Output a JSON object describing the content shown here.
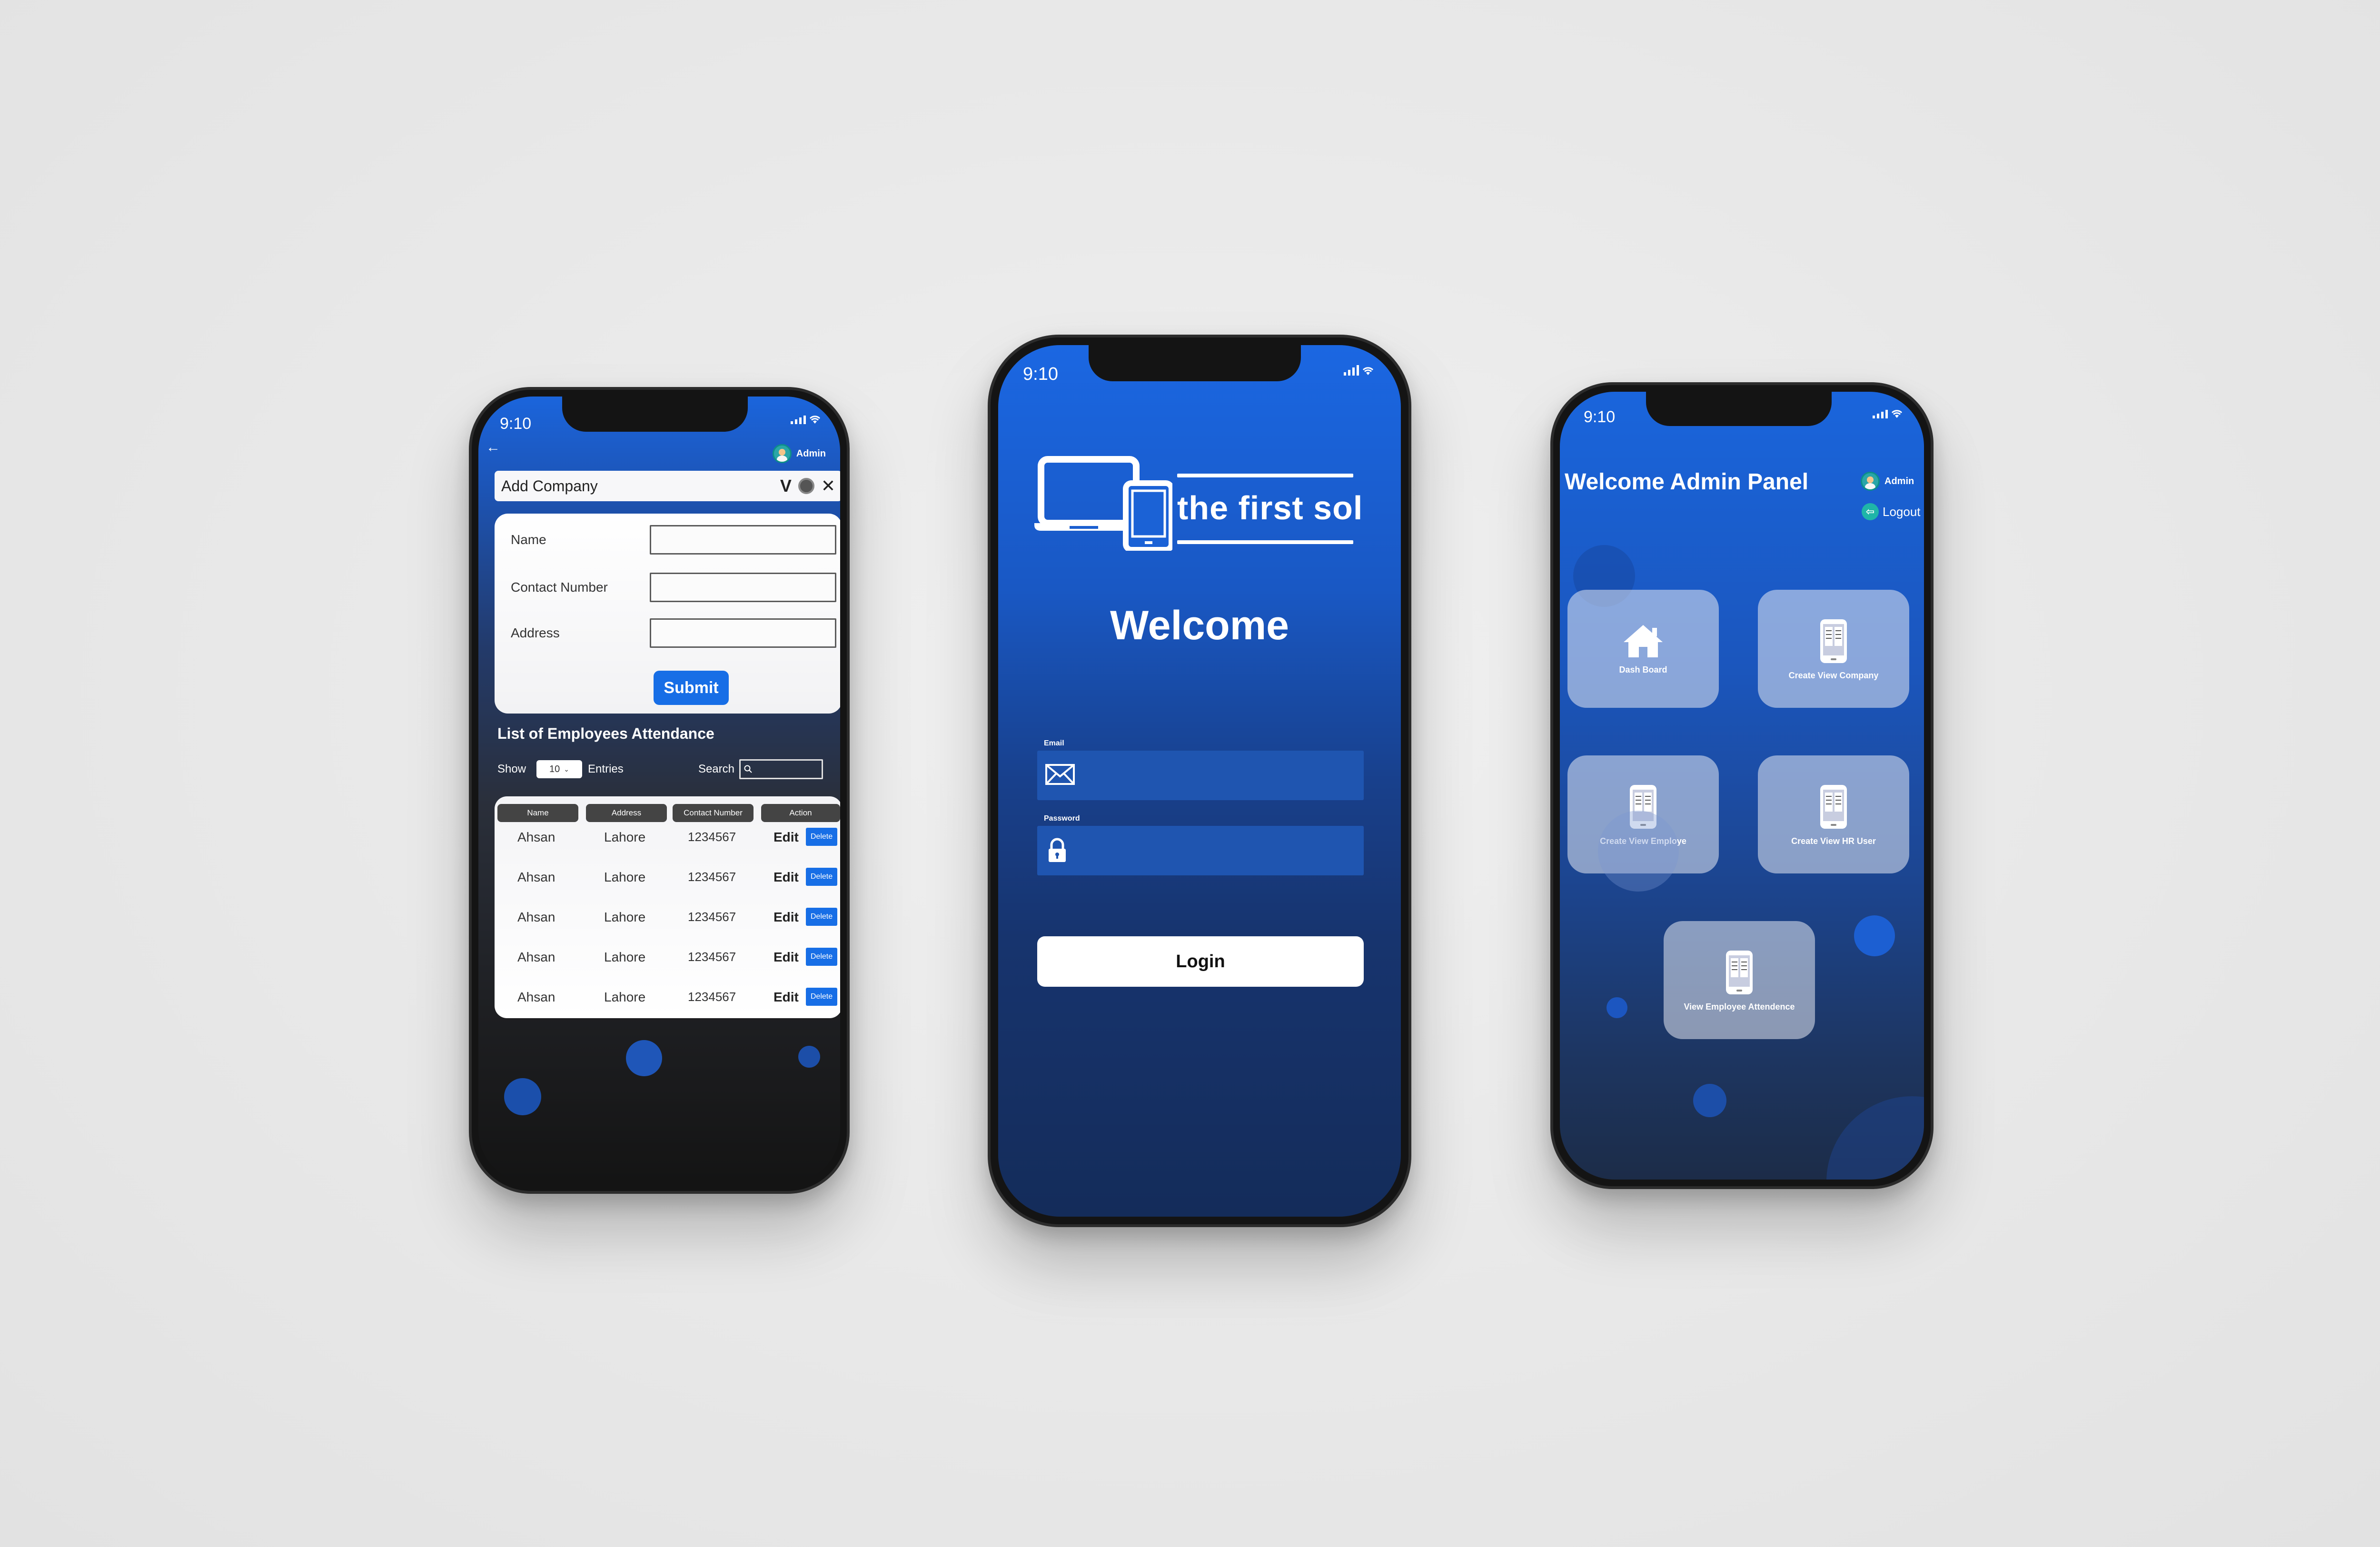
{
  "phone_left": {
    "status": {
      "time": "9:10"
    },
    "admin_label": "Admin",
    "add_company": {
      "title": "Add Company",
      "minimize_label": "V",
      "close_label": "✕"
    },
    "form": {
      "fields": [
        {
          "label": "Name"
        },
        {
          "label": "Contact Number"
        },
        {
          "label": "Address"
        }
      ],
      "submit_label": "Submit"
    },
    "list": {
      "title": "List of Employees Attendance",
      "show_label": "Show",
      "show_value": "10",
      "entries_label": "Entries",
      "search_label": "Search",
      "columns": [
        "Name",
        "Address",
        "Contact Number",
        "Action"
      ],
      "rows": [
        {
          "name": "Ahsan",
          "address": "Lahore",
          "contact": "1234567",
          "edit": "Edit",
          "delete": "Delete"
        },
        {
          "name": "Ahsan",
          "address": "Lahore",
          "contact": "1234567",
          "edit": "Edit",
          "delete": "Delete"
        },
        {
          "name": "Ahsan",
          "address": "Lahore",
          "contact": "1234567",
          "edit": "Edit",
          "delete": "Delete"
        },
        {
          "name": "Ahsan",
          "address": "Lahore",
          "contact": "1234567",
          "edit": "Edit",
          "delete": "Delete"
        },
        {
          "name": "Ahsan",
          "address": "Lahore",
          "contact": "1234567",
          "edit": "Edit",
          "delete": "Delete"
        }
      ]
    }
  },
  "phone_center": {
    "status": {
      "time": "9:10"
    },
    "logo_text": "the first sol",
    "welcome": "Welcome",
    "email_label": "Email",
    "password_label": "Password",
    "login_label": "Login"
  },
  "phone_right": {
    "status": {
      "time": "9:10"
    },
    "title": "Welcome Admin Panel",
    "admin_label": "Admin",
    "logout_label": "Logout",
    "tiles": [
      {
        "label": "Dash Board",
        "icon": "home-icon"
      },
      {
        "label": "Create View Company",
        "icon": "phone-document-icon"
      },
      {
        "label": "Create View Employe",
        "icon": "phone-document-icon"
      },
      {
        "label": "Create View HR User",
        "icon": "phone-document-icon"
      },
      {
        "label": "View Employee Attendence",
        "icon": "phone-document-icon"
      }
    ]
  },
  "colors": {
    "accent_blue": "#176ee6",
    "screen_blue": "#1b65dc",
    "dark": "#141414",
    "background": "#e8e8e8"
  }
}
